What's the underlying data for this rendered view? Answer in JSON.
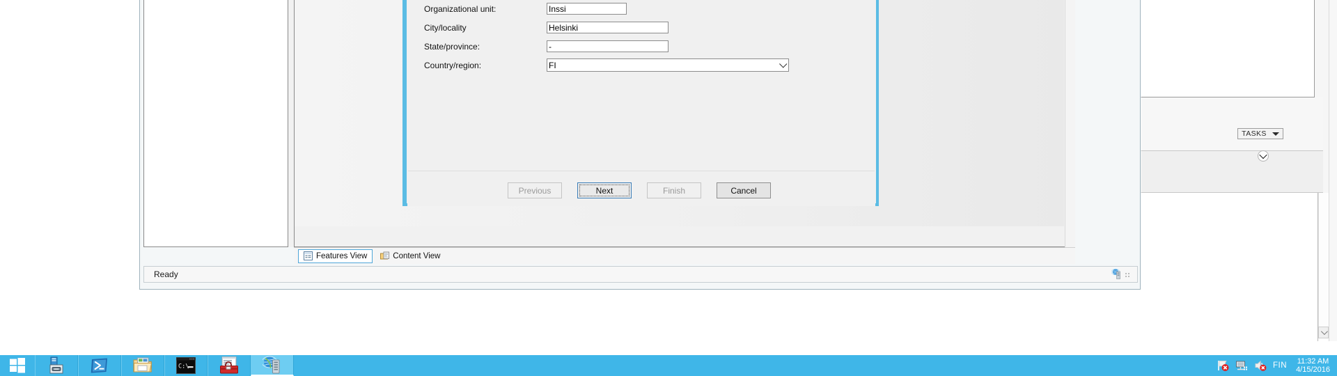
{
  "window": {
    "status_text": "Ready",
    "tabs": [
      {
        "label": "Features View",
        "icon": "features-view-icon",
        "selected": true
      },
      {
        "label": "Content View",
        "icon": "content-view-icon",
        "selected": false
      }
    ],
    "status_icon": "iis-server-globe-icon",
    "resize_grip": "resize-grip-icon"
  },
  "server_manager": {
    "tasks_label": "TASKS",
    "tasks_caret": "caret-down-icon",
    "collapse_icon": "chevron-down-circle-icon",
    "scroll_down_icon": "scroll-down-arrow-icon"
  },
  "wizard": {
    "accent_color": "#5bbce4",
    "fields": [
      {
        "label": "Organizational unit:",
        "value": "Inssi",
        "type": "text",
        "size": "short"
      },
      {
        "label": "City/locality",
        "value": "Helsinki",
        "type": "text",
        "size": "med"
      },
      {
        "label": "State/province:",
        "value": "-",
        "type": "text",
        "size": "med"
      },
      {
        "label": "Country/region:",
        "value": "FI",
        "type": "combo",
        "size": "combo"
      }
    ],
    "buttons": [
      {
        "id": "previous",
        "label": "Previous",
        "state": "disabled"
      },
      {
        "id": "next",
        "label": "Next",
        "state": "default"
      },
      {
        "id": "finish",
        "label": "Finish",
        "state": "disabled"
      },
      {
        "id": "cancel",
        "label": "Cancel",
        "state": "normal"
      }
    ]
  },
  "taskbar": {
    "start_icon": "windows-start-icon",
    "items": [
      {
        "name": "server-manager",
        "icon": "server-manager-icon",
        "active": false
      },
      {
        "name": "powershell",
        "icon": "powershell-icon",
        "active": false
      },
      {
        "name": "file-explorer",
        "icon": "file-explorer-icon",
        "active": false
      },
      {
        "name": "command-prompt",
        "icon": "command-prompt-icon",
        "active": false
      },
      {
        "name": "toolbox-app",
        "icon": "red-toolbox-icon",
        "active": false
      },
      {
        "name": "iis-manager",
        "icon": "iis-manager-icon",
        "active": true
      }
    ],
    "tray": {
      "icons": [
        "flag-alert-icon",
        "network-icon",
        "volume-muted-icon"
      ],
      "language": "FIN",
      "time": "11:32 AM",
      "date": "4/15/2016"
    }
  }
}
